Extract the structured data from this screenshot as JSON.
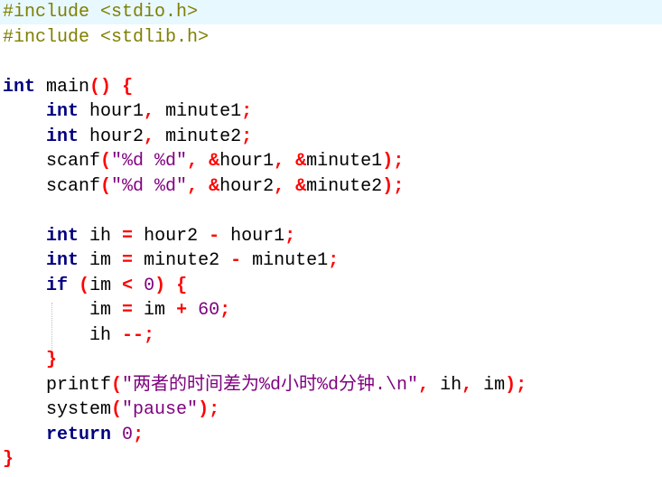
{
  "code": {
    "lines": [
      {
        "tokens": [
          {
            "t": "#include <stdio.h>",
            "c": "pp"
          }
        ]
      },
      {
        "tokens": [
          {
            "t": "#include <stdlib.h>",
            "c": "pp"
          }
        ]
      },
      {
        "tokens": []
      },
      {
        "tokens": [
          {
            "t": "int",
            "c": "kw"
          },
          {
            "t": " main",
            "c": ""
          },
          {
            "t": "()",
            "c": "op"
          },
          {
            "t": " ",
            "c": ""
          },
          {
            "t": "{",
            "c": "op"
          }
        ]
      },
      {
        "tokens": [
          {
            "t": "    ",
            "c": ""
          },
          {
            "t": "int",
            "c": "kw"
          },
          {
            "t": " hour1",
            "c": ""
          },
          {
            "t": ",",
            "c": "op"
          },
          {
            "t": " minute1",
            "c": ""
          },
          {
            "t": ";",
            "c": "op"
          }
        ]
      },
      {
        "tokens": [
          {
            "t": "    ",
            "c": ""
          },
          {
            "t": "int",
            "c": "kw"
          },
          {
            "t": " hour2",
            "c": ""
          },
          {
            "t": ",",
            "c": "op"
          },
          {
            "t": " minute2",
            "c": ""
          },
          {
            "t": ";",
            "c": "op"
          }
        ]
      },
      {
        "tokens": [
          {
            "t": "    scanf",
            "c": ""
          },
          {
            "t": "(",
            "c": "op"
          },
          {
            "t": "\"%d %d\"",
            "c": "str"
          },
          {
            "t": ",",
            "c": "op"
          },
          {
            "t": " ",
            "c": ""
          },
          {
            "t": "&",
            "c": "op"
          },
          {
            "t": "hour1",
            "c": ""
          },
          {
            "t": ",",
            "c": "op"
          },
          {
            "t": " ",
            "c": ""
          },
          {
            "t": "&",
            "c": "op"
          },
          {
            "t": "minute1",
            "c": ""
          },
          {
            "t": ");",
            "c": "op"
          }
        ]
      },
      {
        "tokens": [
          {
            "t": "    scanf",
            "c": ""
          },
          {
            "t": "(",
            "c": "op"
          },
          {
            "t": "\"%d %d\"",
            "c": "str"
          },
          {
            "t": ",",
            "c": "op"
          },
          {
            "t": " ",
            "c": ""
          },
          {
            "t": "&",
            "c": "op"
          },
          {
            "t": "hour2",
            "c": ""
          },
          {
            "t": ",",
            "c": "op"
          },
          {
            "t": " ",
            "c": ""
          },
          {
            "t": "&",
            "c": "op"
          },
          {
            "t": "minute2",
            "c": ""
          },
          {
            "t": ");",
            "c": "op"
          }
        ]
      },
      {
        "tokens": []
      },
      {
        "tokens": [
          {
            "t": "    ",
            "c": ""
          },
          {
            "t": "int",
            "c": "kw"
          },
          {
            "t": " ih ",
            "c": ""
          },
          {
            "t": "=",
            "c": "op"
          },
          {
            "t": " hour2 ",
            "c": ""
          },
          {
            "t": "-",
            "c": "op"
          },
          {
            "t": " hour1",
            "c": ""
          },
          {
            "t": ";",
            "c": "op"
          }
        ]
      },
      {
        "tokens": [
          {
            "t": "    ",
            "c": ""
          },
          {
            "t": "int",
            "c": "kw"
          },
          {
            "t": " im ",
            "c": ""
          },
          {
            "t": "=",
            "c": "op"
          },
          {
            "t": " minute2 ",
            "c": ""
          },
          {
            "t": "-",
            "c": "op"
          },
          {
            "t": " minute1",
            "c": ""
          },
          {
            "t": ";",
            "c": "op"
          }
        ]
      },
      {
        "tokens": [
          {
            "t": "    ",
            "c": ""
          },
          {
            "t": "if",
            "c": "kw"
          },
          {
            "t": " ",
            "c": ""
          },
          {
            "t": "(",
            "c": "op"
          },
          {
            "t": "im ",
            "c": ""
          },
          {
            "t": "<",
            "c": "op"
          },
          {
            "t": " ",
            "c": ""
          },
          {
            "t": "0",
            "c": "num"
          },
          {
            "t": ")",
            "c": "op"
          },
          {
            "t": " ",
            "c": ""
          },
          {
            "t": "{",
            "c": "op"
          }
        ]
      },
      {
        "tokens": [
          {
            "t": "        im ",
            "c": ""
          },
          {
            "t": "=",
            "c": "op"
          },
          {
            "t": " im ",
            "c": ""
          },
          {
            "t": "+",
            "c": "op"
          },
          {
            "t": " ",
            "c": ""
          },
          {
            "t": "60",
            "c": "num"
          },
          {
            "t": ";",
            "c": "op"
          }
        ]
      },
      {
        "tokens": [
          {
            "t": "        ih ",
            "c": ""
          },
          {
            "t": "--;",
            "c": "op"
          }
        ]
      },
      {
        "tokens": [
          {
            "t": "    ",
            "c": ""
          },
          {
            "t": "}",
            "c": "op"
          }
        ]
      },
      {
        "tokens": [
          {
            "t": "    printf",
            "c": ""
          },
          {
            "t": "(",
            "c": "op"
          },
          {
            "t": "\"两者的时间差为%d小时%d分钟.\\n\"",
            "c": "str"
          },
          {
            "t": ",",
            "c": "op"
          },
          {
            "t": " ih",
            "c": ""
          },
          {
            "t": ",",
            "c": "op"
          },
          {
            "t": " im",
            "c": ""
          },
          {
            "t": ");",
            "c": "op"
          }
        ]
      },
      {
        "tokens": [
          {
            "t": "    system",
            "c": ""
          },
          {
            "t": "(",
            "c": "op"
          },
          {
            "t": "\"pause\"",
            "c": "str"
          },
          {
            "t": ");",
            "c": "op"
          }
        ]
      },
      {
        "tokens": [
          {
            "t": "    ",
            "c": ""
          },
          {
            "t": "return",
            "c": "kw"
          },
          {
            "t": " ",
            "c": ""
          },
          {
            "t": "0",
            "c": "num"
          },
          {
            "t": ";",
            "c": "op"
          }
        ]
      },
      {
        "tokens": [
          {
            "t": "}",
            "c": "op"
          }
        ]
      }
    ],
    "current_line": 0
  },
  "colors": {
    "keyword": "#00007f",
    "operator": "#ff0000",
    "string": "#7f007f",
    "number": "#7f007f",
    "preprocessor": "#7f7f00",
    "current_line_bg": "#e8f8ff"
  }
}
